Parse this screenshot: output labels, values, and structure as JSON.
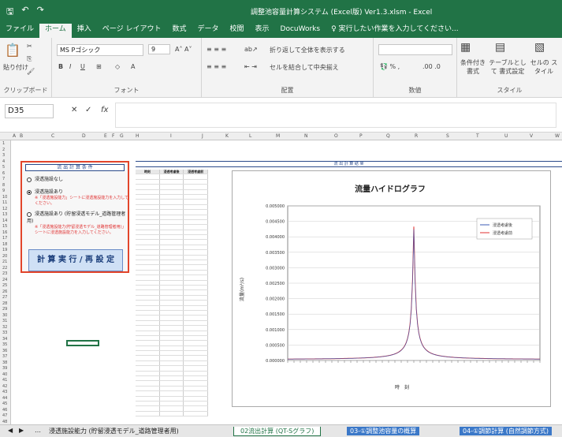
{
  "title": {
    "window": "調整池容量計算システム (Excel版) Ver1.3.xlsm - Excel"
  },
  "tabs": [
    "ファイル",
    "ホーム",
    "挿入",
    "ページ レイアウト",
    "数式",
    "データ",
    "校閲",
    "表示",
    "DocuWorks",
    "♀ 実行したい作業を入力してください..."
  ],
  "ribbon": {
    "paste": "貼り付け",
    "clipboard": "クリップボード",
    "font_name": "MS Pゴシック",
    "font_size": "9",
    "font_group": "フォント",
    "wrap": "折り返して全体を表示する",
    "merge": "セルを結合して中央揃え",
    "align_group": "配置",
    "number_group": "数値",
    "cond_format": "条件付き 書式",
    "table_format": "テーブルとして 書式設定",
    "cell_style": "セルの スタイル",
    "style_group": "スタイル"
  },
  "namebox": "D35",
  "fx": "fx",
  "panel": {
    "header": "流 出 計 算 条 件",
    "opt1": "浸透施設なし",
    "opt2": "浸透施設あり",
    "opt2_note": "※「浸透施設能力」シートに浸透施設能力を入力してください。",
    "opt3": "浸透施設あり (貯留浸透モデル_道路管理者用)",
    "opt3_note": "※「浸透施設能力(貯留浸透モデル_道路管理者用)」シートに浸透施設能力を入力してください。",
    "run": "計 算 実 行 / 再 設 定"
  },
  "results_title": "流 出 計 算 結 果",
  "table": {
    "headers": [
      "時刻",
      "浸透考慮後",
      "浸透考慮前"
    ]
  },
  "chart_data": {
    "type": "line",
    "title": "流量ハイドログラフ",
    "ylabel": "流量(m³/s)",
    "xlabel": "時　刻",
    "ylim": [
      0,
      0.005
    ],
    "yticks": [
      "0.000000",
      "0.000500",
      "0.001000",
      "0.001500",
      "0.002000",
      "0.002500",
      "0.003000",
      "0.003500",
      "0.004000",
      "0.004500",
      "0.005000"
    ],
    "legend": [
      "浸透考慮後",
      "浸透考慮前"
    ],
    "colors": [
      "#3b5bb5",
      "#e03030"
    ],
    "peak_x": 0.5,
    "peak": 0.0043
  },
  "sheets": [
    "浸透施設能力 (貯留浸透モデル_道路管理者用)",
    "02流出計算 (QT-Sグラフ)",
    "03-①調整池容量の概算",
    "04-①調節計算 (自然調節方式)"
  ]
}
